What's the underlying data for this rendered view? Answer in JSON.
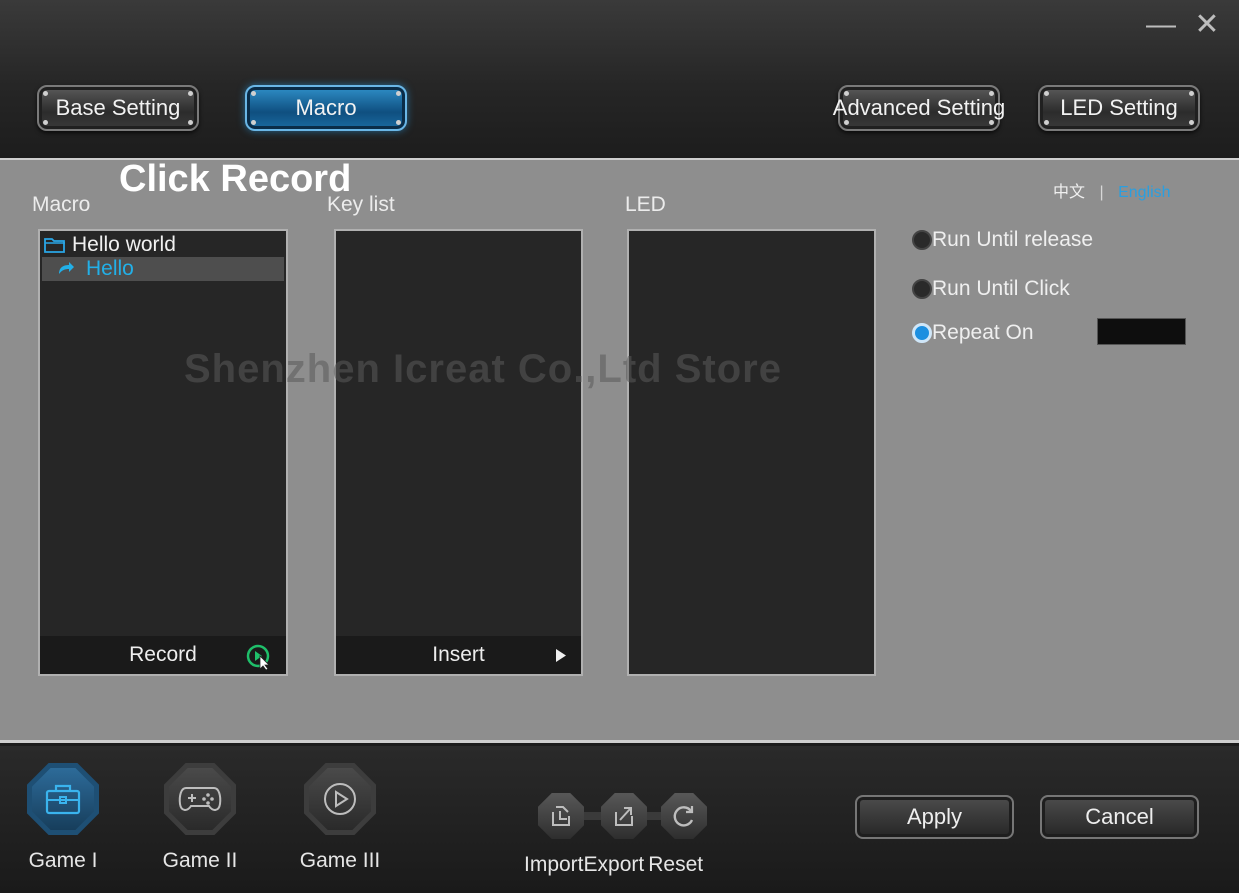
{
  "window": {
    "minimize_glyph": "—",
    "close_glyph": "✕"
  },
  "nav": {
    "base_setting": "Base Setting",
    "macro": "Macro",
    "advanced_setting": "Advanced Setting",
    "led_setting": "LED Setting"
  },
  "overlay_caption": "Click Record",
  "language": {
    "chinese": "中文",
    "separator": "|",
    "english": "English"
  },
  "panels": {
    "macro_label": "Macro",
    "keylist_label": "Key list",
    "led_label": "LED",
    "macro_tree": {
      "folder": "Hello world",
      "item": "Hello"
    },
    "record_label": "Record",
    "insert_label": "Insert"
  },
  "options": {
    "run_until_release": "Run Until release",
    "run_until_click": "Run Until Click",
    "repeat_on": "Repeat On",
    "repeat_value": "",
    "selected": "repeat_on"
  },
  "watermark": "Shenzhen Icreat Co.,Ltd Store",
  "games": {
    "game1": "Game I",
    "game2": "Game II",
    "game3": "Game III",
    "active": "game1"
  },
  "tools": {
    "import": "Import",
    "export": "Export",
    "reset": "Reset"
  },
  "actions": {
    "apply": "Apply",
    "cancel": "Cancel"
  },
  "colors": {
    "accent": "#1c8fe0",
    "link": "#2a9fe0",
    "record_icon": "#1fbf6a"
  }
}
